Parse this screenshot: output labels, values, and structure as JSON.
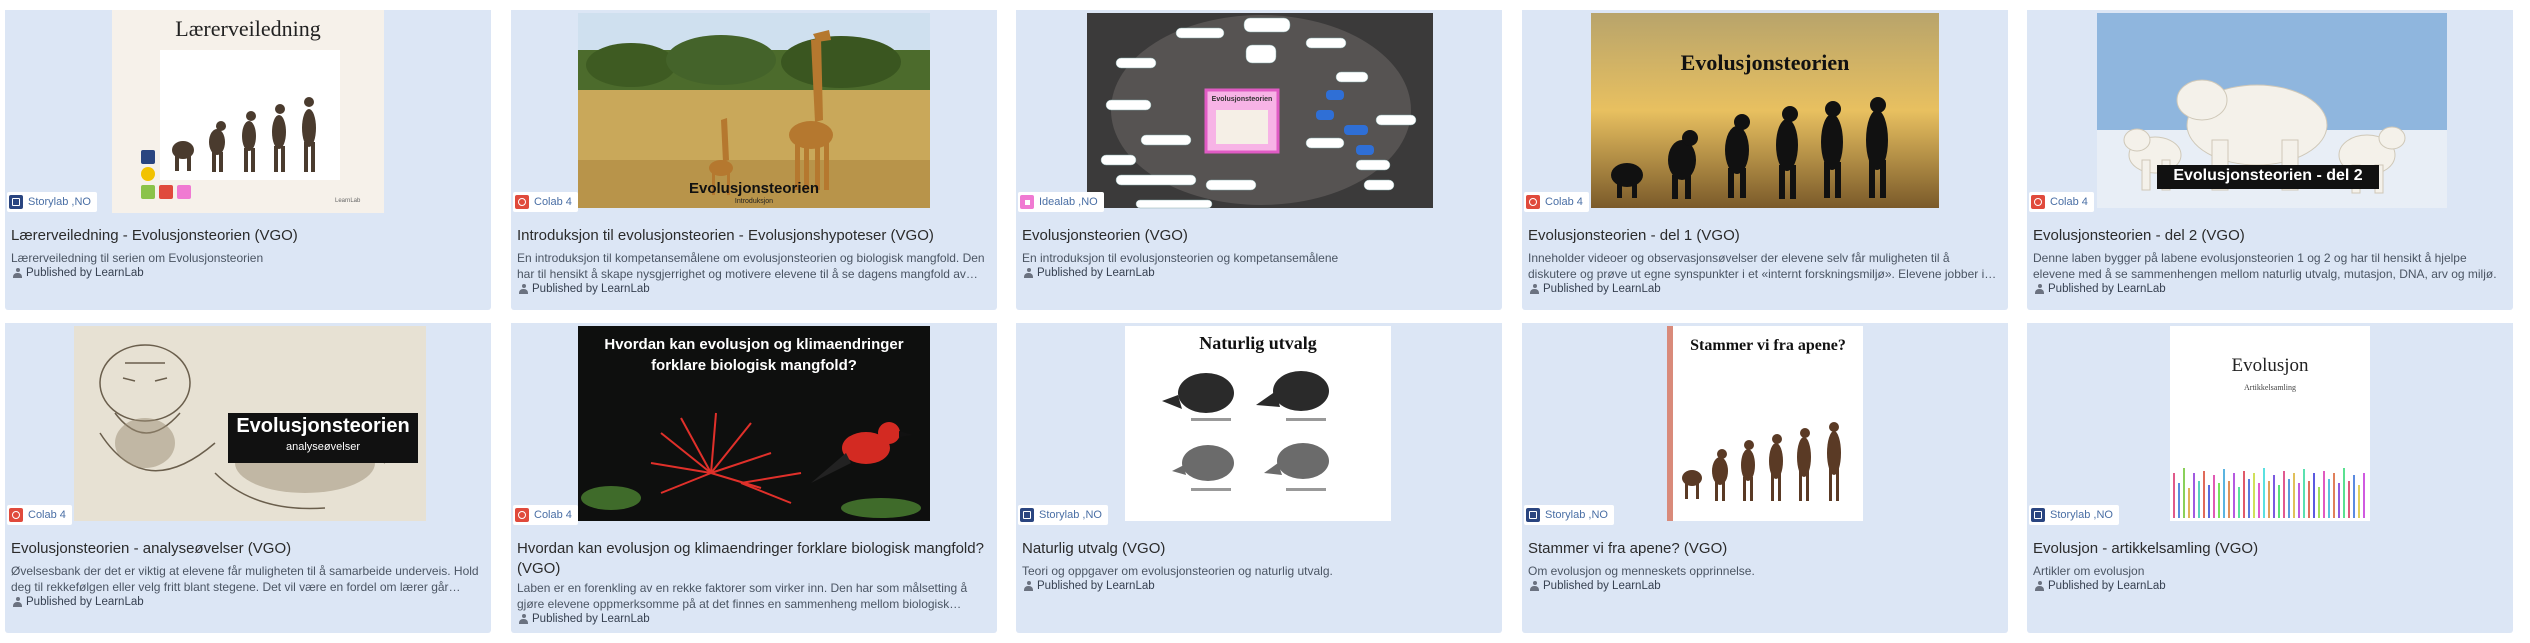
{
  "publisher": "Published by LearnLab",
  "cards": [
    {
      "title": "Lærerveiledning - Evolusjonsteorien (VGO)",
      "desc": "Lærerveiledning til serien om Evolusjonsteorien",
      "badge": "Storylab ,NO",
      "badge_type": "storylab",
      "image_title": "Lærerveiledning",
      "image_small": "LearnLab"
    },
    {
      "title": "Introduksjon til evolusjonsteorien - Evolusjonshypoteser (VGO)",
      "desc": "En introduksjon til kompetansemålene om evolusjonsteorien og biologisk mangfold. Den har til hensikt å skape nysgjerrighet og motivere elevene til å se dagens mangfold av arter i lys av evolusjonsteorien.",
      "badge": "Colab 4",
      "badge_type": "colab",
      "image_title": "Evolusjonsteorien",
      "image_small": "Introduksjon"
    },
    {
      "title": "Evolusjonsteorien (VGO)",
      "desc": "En introduksjon til evolusjonsteorien og kompetansemålene",
      "badge": "Idealab ,NO",
      "badge_type": "idealab",
      "image_title": "Evolusjonsteorien",
      "image_small": ""
    },
    {
      "title": "Evolusjonsteorien - del 1 (VGO)",
      "desc": "Inneholder videoer og observasjonsøvelser der elevene selv får muligheten til å diskutere og prøve ut egne synspunkter i et «internt forskningsmiljø». Elevene jobber i grupper.",
      "badge": "Colab 4",
      "badge_type": "colab",
      "image_title": "Evolusjonsteorien",
      "image_small": ""
    },
    {
      "title": "Evolusjonsteorien - del 2 (VGO)",
      "desc": "Denne laben bygger på labene evolusjonsteorien 1 og 2 og har til hensikt å hjelpe elevene med å se sammenhengen mellom naturlig utvalg, mutasjon, DNA, arv og miljø.",
      "badge": "Colab 4",
      "badge_type": "colab",
      "image_title": "Evolusjonsteorien - del 2",
      "image_small": ""
    },
    {
      "title": "Evolusjonsteorien - analyseøvelser (VGO)",
      "desc": "Øvelsesbank der det er viktig at elevene får muligheten til å samarbeide underveis. Hold deg til rekkefølgen eller velg fritt blant stegene. Det vil være en fordel om lærer går gjennom svarene.",
      "badge": "Colab 4",
      "badge_type": "colab",
      "image_title": "Evolusjonsteorien",
      "image_small": "analyseøvelser"
    },
    {
      "title": "Hvordan kan evolusjon og klimaendringer forklare biologisk mangfold? (VGO)",
      "desc": "Laben er en forenkling av en rekke faktorer som virker inn. Den har som målsetting å gjøre elevene oppmerksomme på at det finnes en sammenheng mellom biologisk mangfold og klimaendringer.",
      "badge": "Colab 4",
      "badge_type": "colab",
      "image_title": "Hvordan kan evolusjon og klimaendringer forklare biologisk mangfold?",
      "image_small": ""
    },
    {
      "title": "Naturlig utvalg (VGO)",
      "desc": "Teori og oppgaver om evolusjonsteorien og naturlig utvalg.",
      "badge": "Storylab ,NO",
      "badge_type": "storylab",
      "image_title": "Naturlig utvalg",
      "image_small": ""
    },
    {
      "title": "Stammer vi fra apene? (VGO)",
      "desc": "Om evolusjon og menneskets opprinnelse.",
      "badge": "Storylab ,NO",
      "badge_type": "storylab",
      "image_title": "Stammer vi fra apene?",
      "image_small": ""
    },
    {
      "title": "Evolusjon - artikkelsamling (VGO)",
      "desc": "Artikler om evolusjon",
      "badge": "Storylab ,NO",
      "badge_type": "storylab",
      "image_title": "Evolusjon",
      "image_small": "Artikkelsamling"
    }
  ]
}
